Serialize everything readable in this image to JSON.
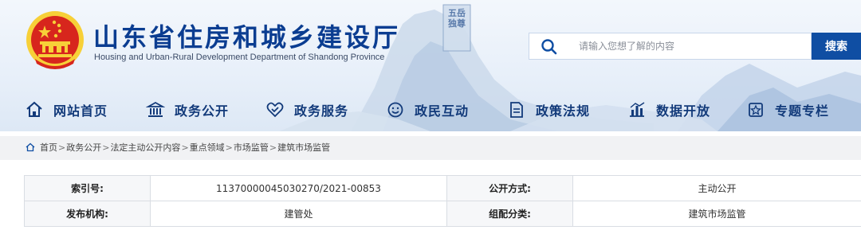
{
  "header": {
    "title": "山东省住房和城乡建设厅",
    "subtitle": "Housing and Urban-Rural Development Department of Shandong Province",
    "search": {
      "placeholder": "请输入您想了解的内容",
      "button_label": "搜索"
    },
    "mountain_inscription": "五岳独尊"
  },
  "colors": {
    "brand_blue": "#0f4ea3",
    "title_blue": "#0b3d91",
    "emblem_red": "#d7261d",
    "emblem_gold": "#f7d038"
  },
  "nav": {
    "items": [
      {
        "label": "网站首页",
        "icon": "home-icon"
      },
      {
        "label": "政务公开",
        "icon": "government-building-icon"
      },
      {
        "label": "政务服务",
        "icon": "handshake-icon"
      },
      {
        "label": "政民互动",
        "icon": "interaction-icon"
      },
      {
        "label": "政策法规",
        "icon": "document-icon"
      },
      {
        "label": "数据开放",
        "icon": "bar-chart-icon"
      },
      {
        "label": "专题专栏",
        "icon": "special-topic-icon"
      }
    ]
  },
  "breadcrumb": {
    "items": [
      "首页",
      "政务公开",
      "法定主动公开内容",
      "重点领域",
      "市场监管",
      "建筑市场监管"
    ],
    "separator": ">"
  },
  "info_table": {
    "rows": [
      {
        "label1": "索引号:",
        "value1": "11370000045030270/2021-00853",
        "label2": "公开方式:",
        "value2": "主动公开"
      },
      {
        "label1": "发布机构:",
        "value1": "建管处",
        "label2": "组配分类:",
        "value2": "建筑市场监管"
      }
    ]
  }
}
